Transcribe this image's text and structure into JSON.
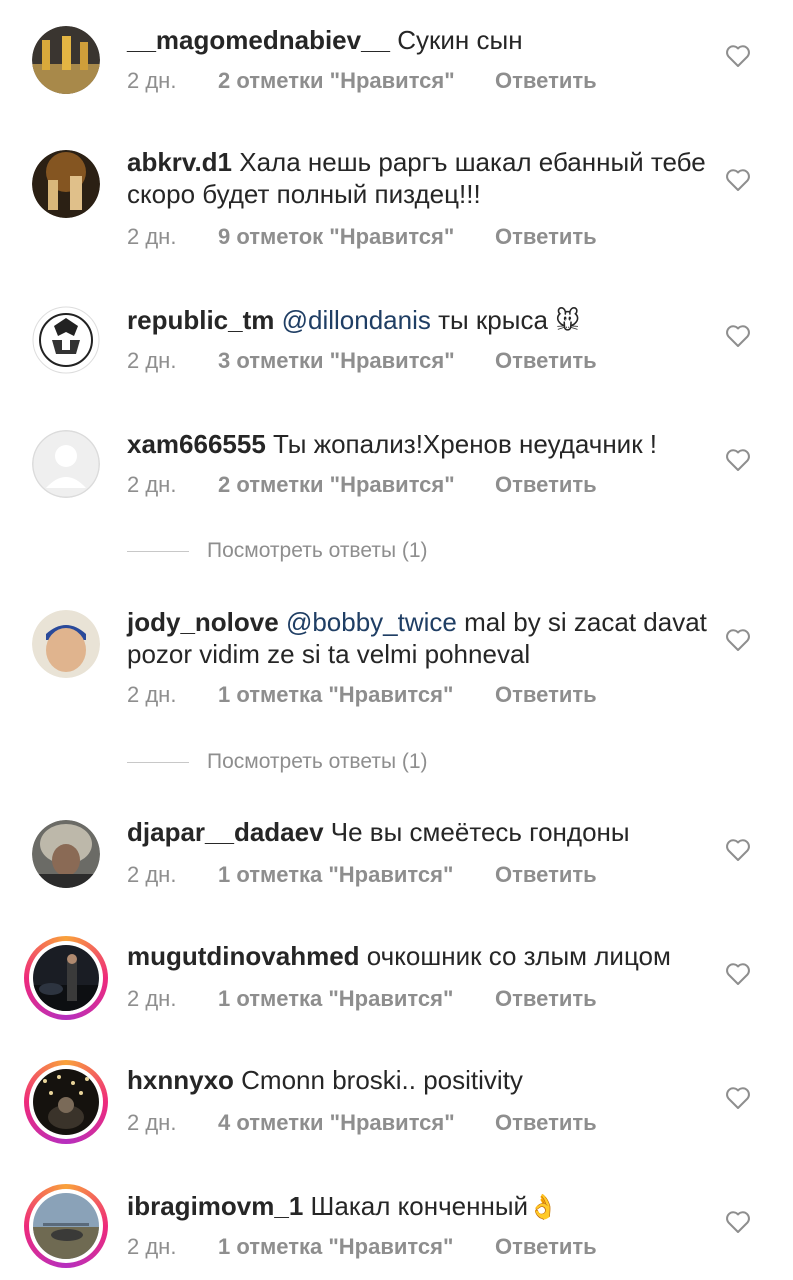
{
  "comments": [
    {
      "username": "__magomednabiev__",
      "mention": "",
      "text": "Сукин сын",
      "emoji": "",
      "time": "2 дн.",
      "likes": "2 отметки \"Нравится\"",
      "reply": "Ответить"
    },
    {
      "username": "abkrv.d1",
      "mention": "",
      "text": "Хала нешь раргъ шакал ебанный тебе скоро будет полный пиздец!!!",
      "emoji": "",
      "time": "2 дн.",
      "likes": "9 отметок \"Нравится\"",
      "reply": "Ответить"
    },
    {
      "username": "republic_tm",
      "mention": "@dillondanis",
      "text": " ты крыса",
      "emoji": "🐭",
      "time": "2 дн.",
      "likes": "3 отметки \"Нравится\"",
      "reply": "Ответить"
    },
    {
      "username": "xam666555",
      "mention": "",
      "text": "Ты жопализ!Хренов неудачник !",
      "emoji": "",
      "time": "2 дн.",
      "likes": "2 отметки \"Нравится\"",
      "reply": "Ответить",
      "view_replies": "Посмотреть ответы (1)"
    },
    {
      "username": "jody_nolove",
      "mention": "@bobby_twice",
      "text": "mal by si zacat davat pozor vidim ze si ta velmi pohneval",
      "emoji": "",
      "time": "2 дн.",
      "likes": "1 отметка \"Нравится\"",
      "reply": "Ответить",
      "view_replies": "Посмотреть ответы (1)"
    },
    {
      "username": "djapar__dadaev",
      "mention": "",
      "text": "Че вы смеётесь гондоны",
      "emoji": "",
      "time": "2 дн.",
      "likes": "1 отметка \"Нравится\"",
      "reply": "Ответить"
    },
    {
      "username": "mugutdinovahmed",
      "mention": "",
      "text": "очкошник со злым лицом",
      "emoji": "",
      "time": "2 дн.",
      "likes": "1 отметка \"Нравится\"",
      "reply": "Ответить"
    },
    {
      "username": "hxnnyxo",
      "mention": "",
      "text": "Cmonn broski.. positivity",
      "emoji": "",
      "time": "2 дн.",
      "likes": "4 отметки \"Нравится\"",
      "reply": "Ответить"
    },
    {
      "username": "ibragimovm_1",
      "mention": "",
      "text": "Шакал конченный",
      "emoji": "👌",
      "time": "2 дн.",
      "likes": "1 отметка \"Нравится\"",
      "reply": "Ответить"
    }
  ],
  "icons": {
    "like": "heart-outline-icon"
  },
  "colors": {
    "text": "#262626",
    "meta": "#8e8e8e",
    "mention": "#1f3e64",
    "story_ring": "#ee2a7b"
  }
}
